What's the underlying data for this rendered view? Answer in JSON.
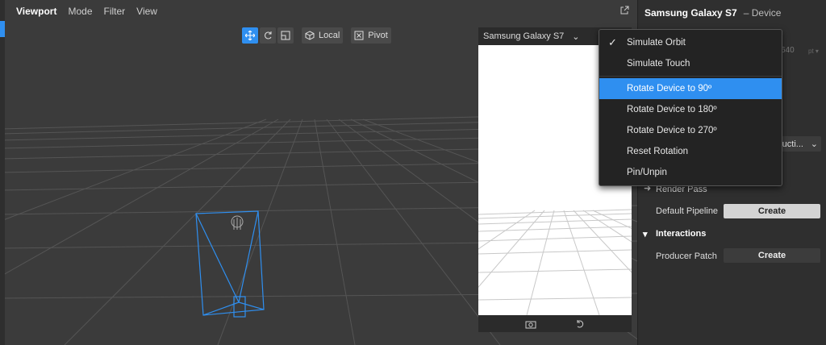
{
  "viewport_menu": {
    "tab": "Viewport",
    "items": [
      "Mode",
      "Filter",
      "View"
    ]
  },
  "toolbar": {
    "local_label": "Local",
    "pivot_label": "Pivot"
  },
  "device": {
    "name": "Samsung Galaxy S7"
  },
  "dropdown": {
    "items": [
      {
        "label": "Simulate Orbit",
        "checked": true
      },
      {
        "label": "Simulate Touch"
      },
      {
        "label": "Rotate Device to 90º",
        "selected": true
      },
      {
        "label": "Rotate Device to 180º"
      },
      {
        "label": "Rotate Device to 270º"
      },
      {
        "label": "Reset Rotation"
      },
      {
        "label": "Pin/Unpin"
      }
    ]
  },
  "panel": {
    "title": "Samsung Galaxy S7",
    "subtitle": "– Device",
    "width_value": "640",
    "width_unit": "pt ▾",
    "dropdown_value": "ructi...",
    "render_pass_label": "Render Pass",
    "default_pipeline_label": "Default Pipeline",
    "create_label": "Create",
    "interactions_label": "Interactions",
    "producer_patch_label": "Producer Patch"
  },
  "colors": {
    "accent": "#2f8ff0",
    "bg": "#3b3b3b",
    "panel": "#2f2f2f"
  }
}
